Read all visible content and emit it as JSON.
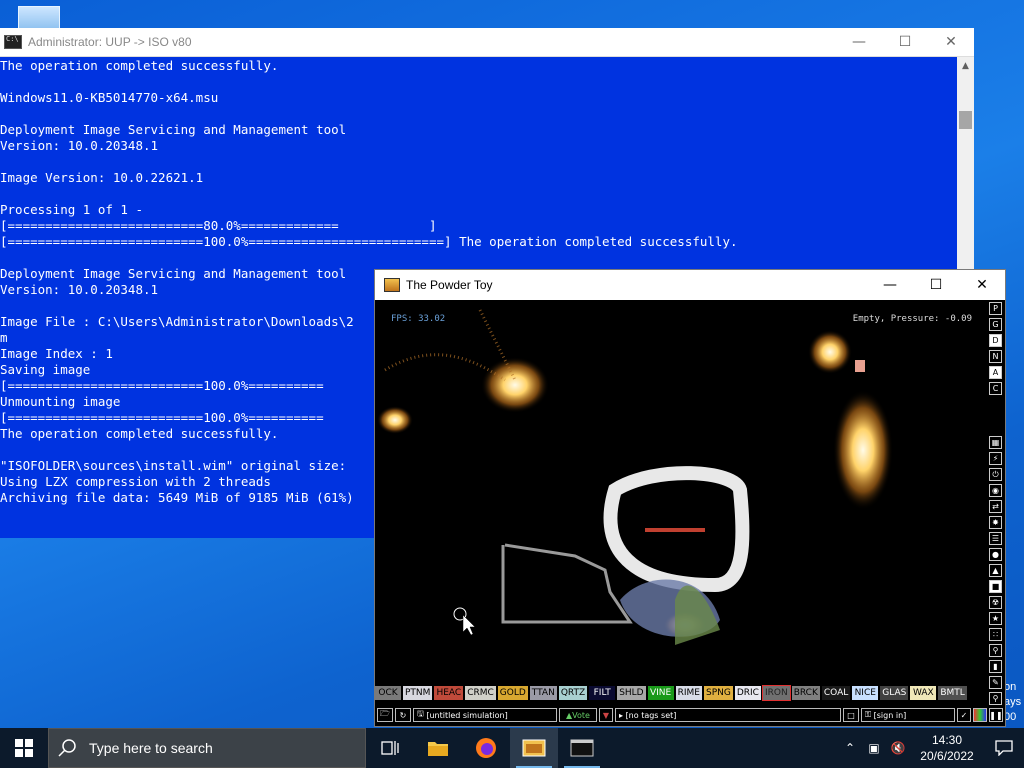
{
  "console": {
    "title": "Administrator:  UUP -> ISO v80",
    "lines": [
      "The operation completed successfully.",
      "",
      "Windows11.0-KB5014770-x64.msu",
      "",
      "Deployment Image Servicing and Management tool",
      "Version: 10.0.20348.1",
      "",
      "Image Version: 10.0.22621.1",
      "",
      "Processing 1 of 1 -",
      "[==========================80.0%=============            ]",
      "[==========================100.0%==========================] The operation completed successfully.",
      "",
      "Deployment Image Servicing and Management tool",
      "Version: 10.0.20348.1",
      "",
      "Image File : C:\\Users\\Administrator\\Downloads\\2",
      "m",
      "Image Index : 1",
      "Saving image",
      "[==========================100.0%==========",
      "Unmounting image",
      "[==========================100.0%==========",
      "The operation completed successfully.",
      "",
      "\"ISOFOLDER\\sources\\install.wim\" original size:",
      "Using LZX compression with 2 threads",
      "Archiving file data: 5649 MiB of 9185 MiB (61%)"
    ]
  },
  "desktop_edge_text": [
    "on",
    "ays",
    "00"
  ],
  "powder_toy": {
    "title": "The Powder Toy",
    "fps": "FPS: 33.02",
    "status": "Empty, Pressure: -0.09",
    "right_buttons": [
      "P",
      "G",
      "D",
      "N",
      "A",
      "C"
    ],
    "elements": [
      {
        "label": "OCK",
        "bg": "#7a7a7a",
        "fg": "#000"
      },
      {
        "label": "PTNM",
        "bg": "#d8d8e0",
        "fg": "#000"
      },
      {
        "label": "HEAC",
        "bg": "#c04a3a",
        "fg": "#000"
      },
      {
        "label": "CRMC",
        "bg": "#d0d0c8",
        "fg": "#000"
      },
      {
        "label": "GOLD",
        "bg": "#d8a830",
        "fg": "#000"
      },
      {
        "label": "TTAN",
        "bg": "#9a9aa6",
        "fg": "#000"
      },
      {
        "label": "QRTZ",
        "bg": "#a8d0d0",
        "fg": "#000"
      },
      {
        "label": "FILT",
        "bg": "#0a0a30",
        "fg": "#fff"
      },
      {
        "label": "SHLD",
        "bg": "#a8a8a8",
        "fg": "#000"
      },
      {
        "label": "VINE",
        "bg": "#1a9a1a",
        "fg": "#fff"
      },
      {
        "label": "RIME",
        "bg": "#d8dce8",
        "fg": "#000"
      },
      {
        "label": "SPNG",
        "bg": "#e0b040",
        "fg": "#000"
      },
      {
        "label": "DRIC",
        "bg": "#e8e8f0",
        "fg": "#000"
      },
      {
        "label": "IRON",
        "bg": "#707070",
        "fg": "#222"
      },
      {
        "label": "BRCK",
        "bg": "#808080",
        "fg": "#000"
      },
      {
        "label": "COAL",
        "bg": "#1a1a1a",
        "fg": "#fff"
      },
      {
        "label": "NICE",
        "bg": "#c8e0ff",
        "fg": "#000"
      },
      {
        "label": "GLAS",
        "bg": "#404040",
        "fg": "#fff"
      },
      {
        "label": "WAX",
        "bg": "#f0e8b8",
        "fg": "#000"
      },
      {
        "label": "BMTL",
        "bg": "#505050",
        "fg": "#fff"
      }
    ],
    "selected_element": "IRON",
    "sim_name": "[untitled simulation]",
    "vote": "Vote",
    "tags": "[no tags set]",
    "sign_in": "[sign in]"
  },
  "taskbar": {
    "search_placeholder": "Type here to search",
    "time": "14:30",
    "date": "20/6/2022"
  }
}
